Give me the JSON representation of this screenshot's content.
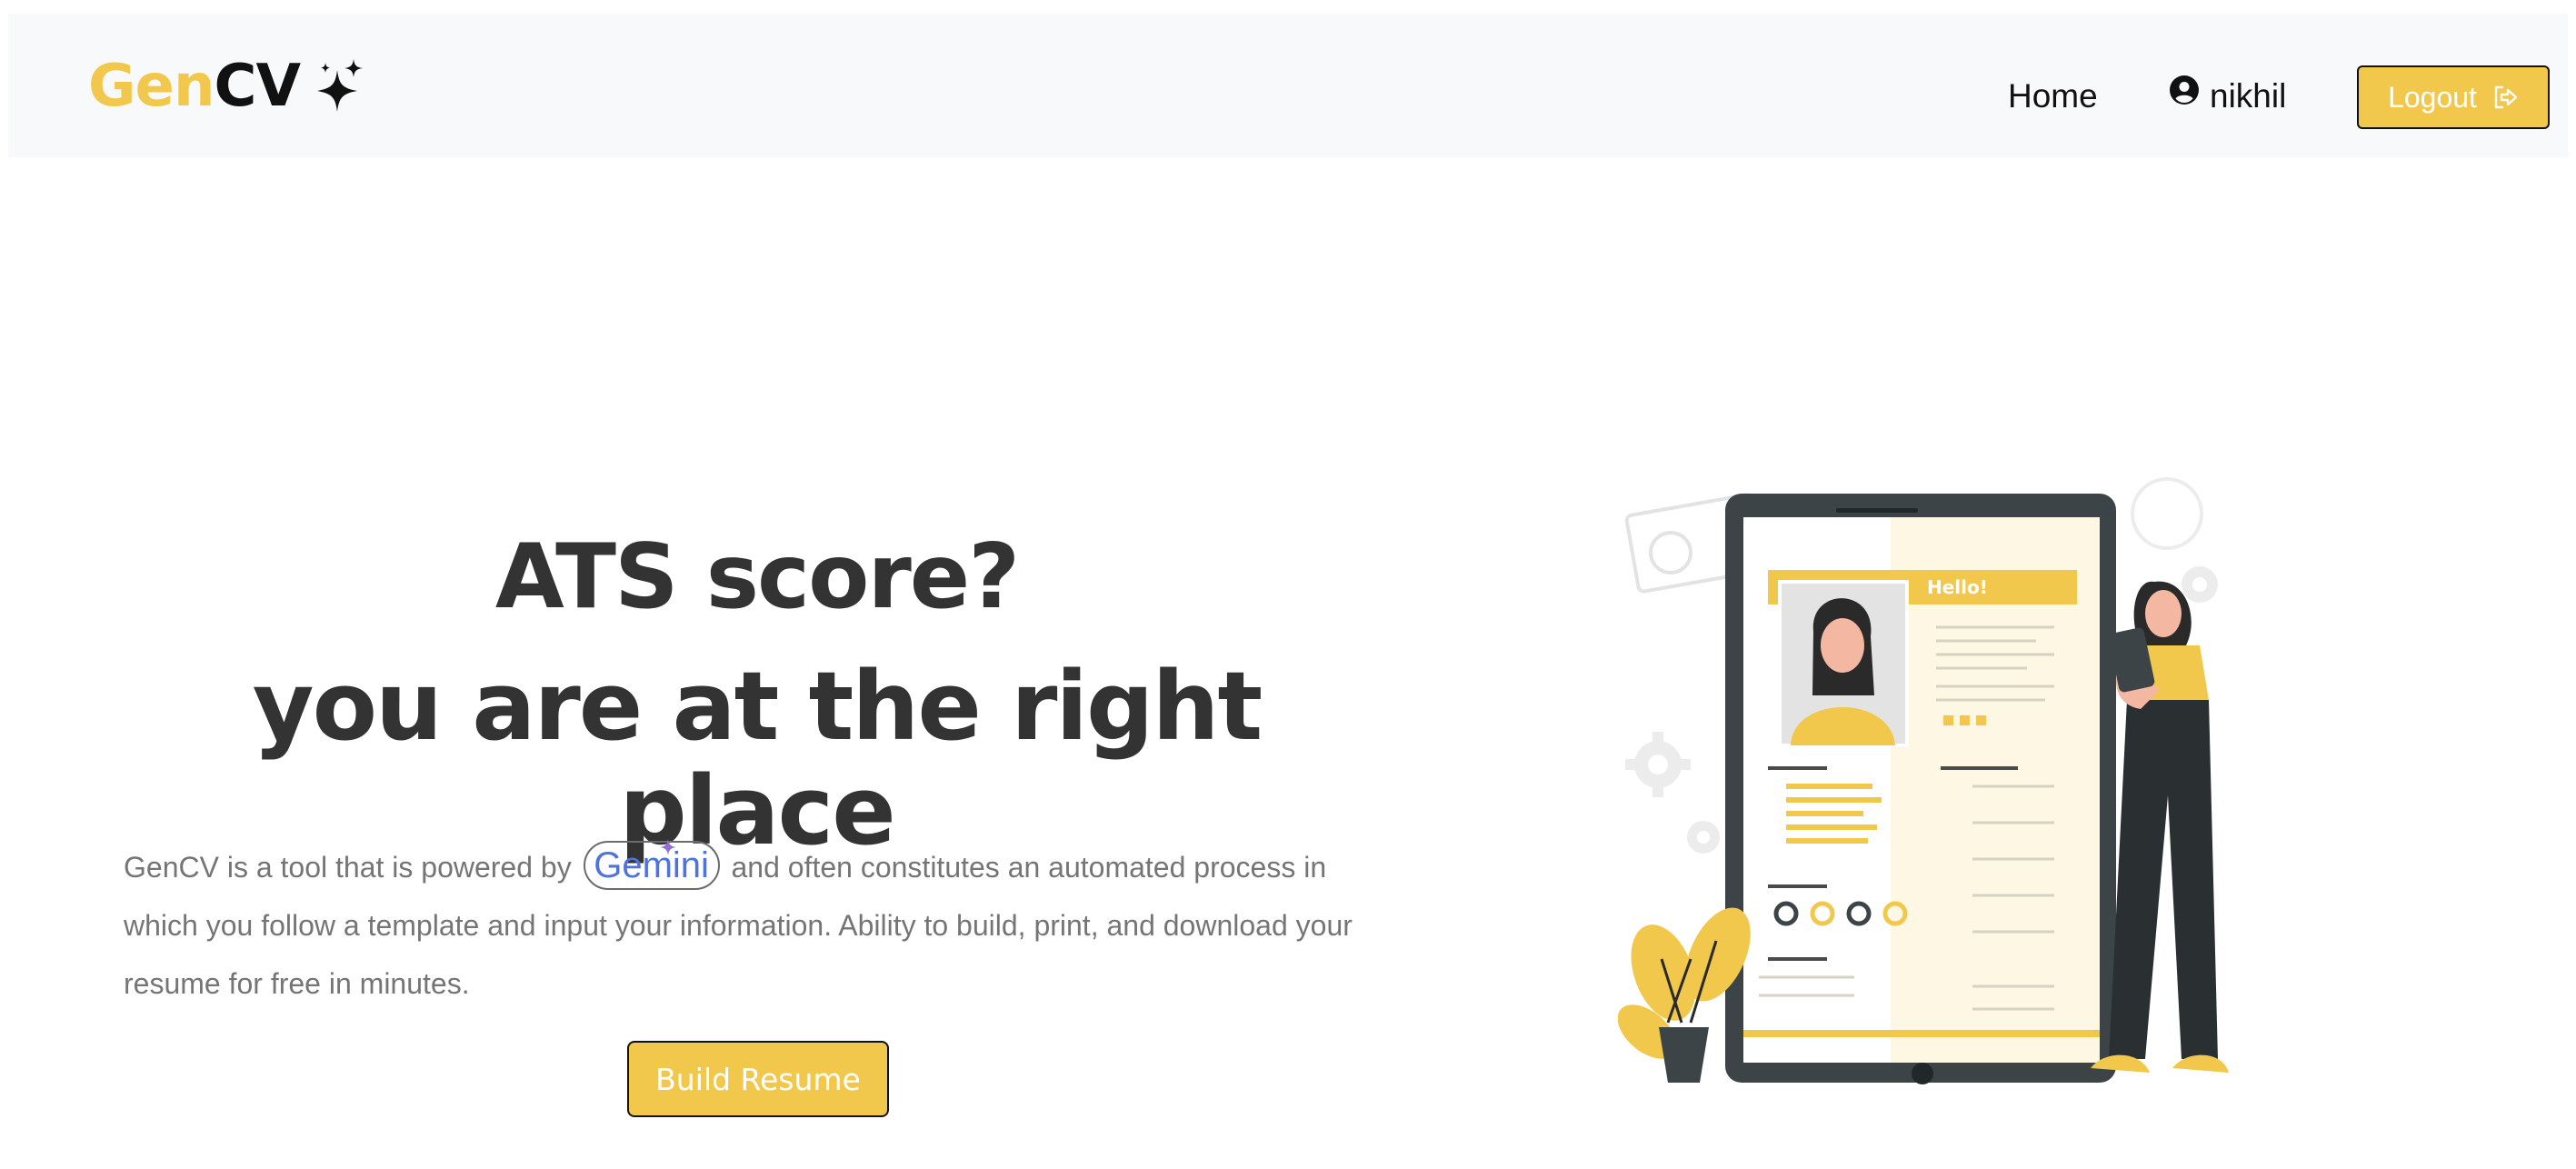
{
  "navbar": {
    "brand_gen": "Gen",
    "brand_cv": "CV",
    "home_label": "Home",
    "username": "nikhil",
    "logout_label": "Logout"
  },
  "hero": {
    "title_line1": "ATS score?",
    "title_line2": "you are at the right place",
    "desc_before": "GenCV is a tool that is powered by",
    "gemini_label": "Gemini",
    "desc_after": "and often constitutes an automated process in which you follow a template and input your information. Ability to build, print, and download your resume for free in minutes.",
    "build_label": "Build Resume"
  },
  "illustration": {
    "hello_label": "Hello!"
  },
  "colors": {
    "accent": "#f1c84b",
    "navbar_bg": "#f8f9fa",
    "heading": "#333333",
    "body_text": "#757575",
    "tablet": "#3d4447"
  }
}
